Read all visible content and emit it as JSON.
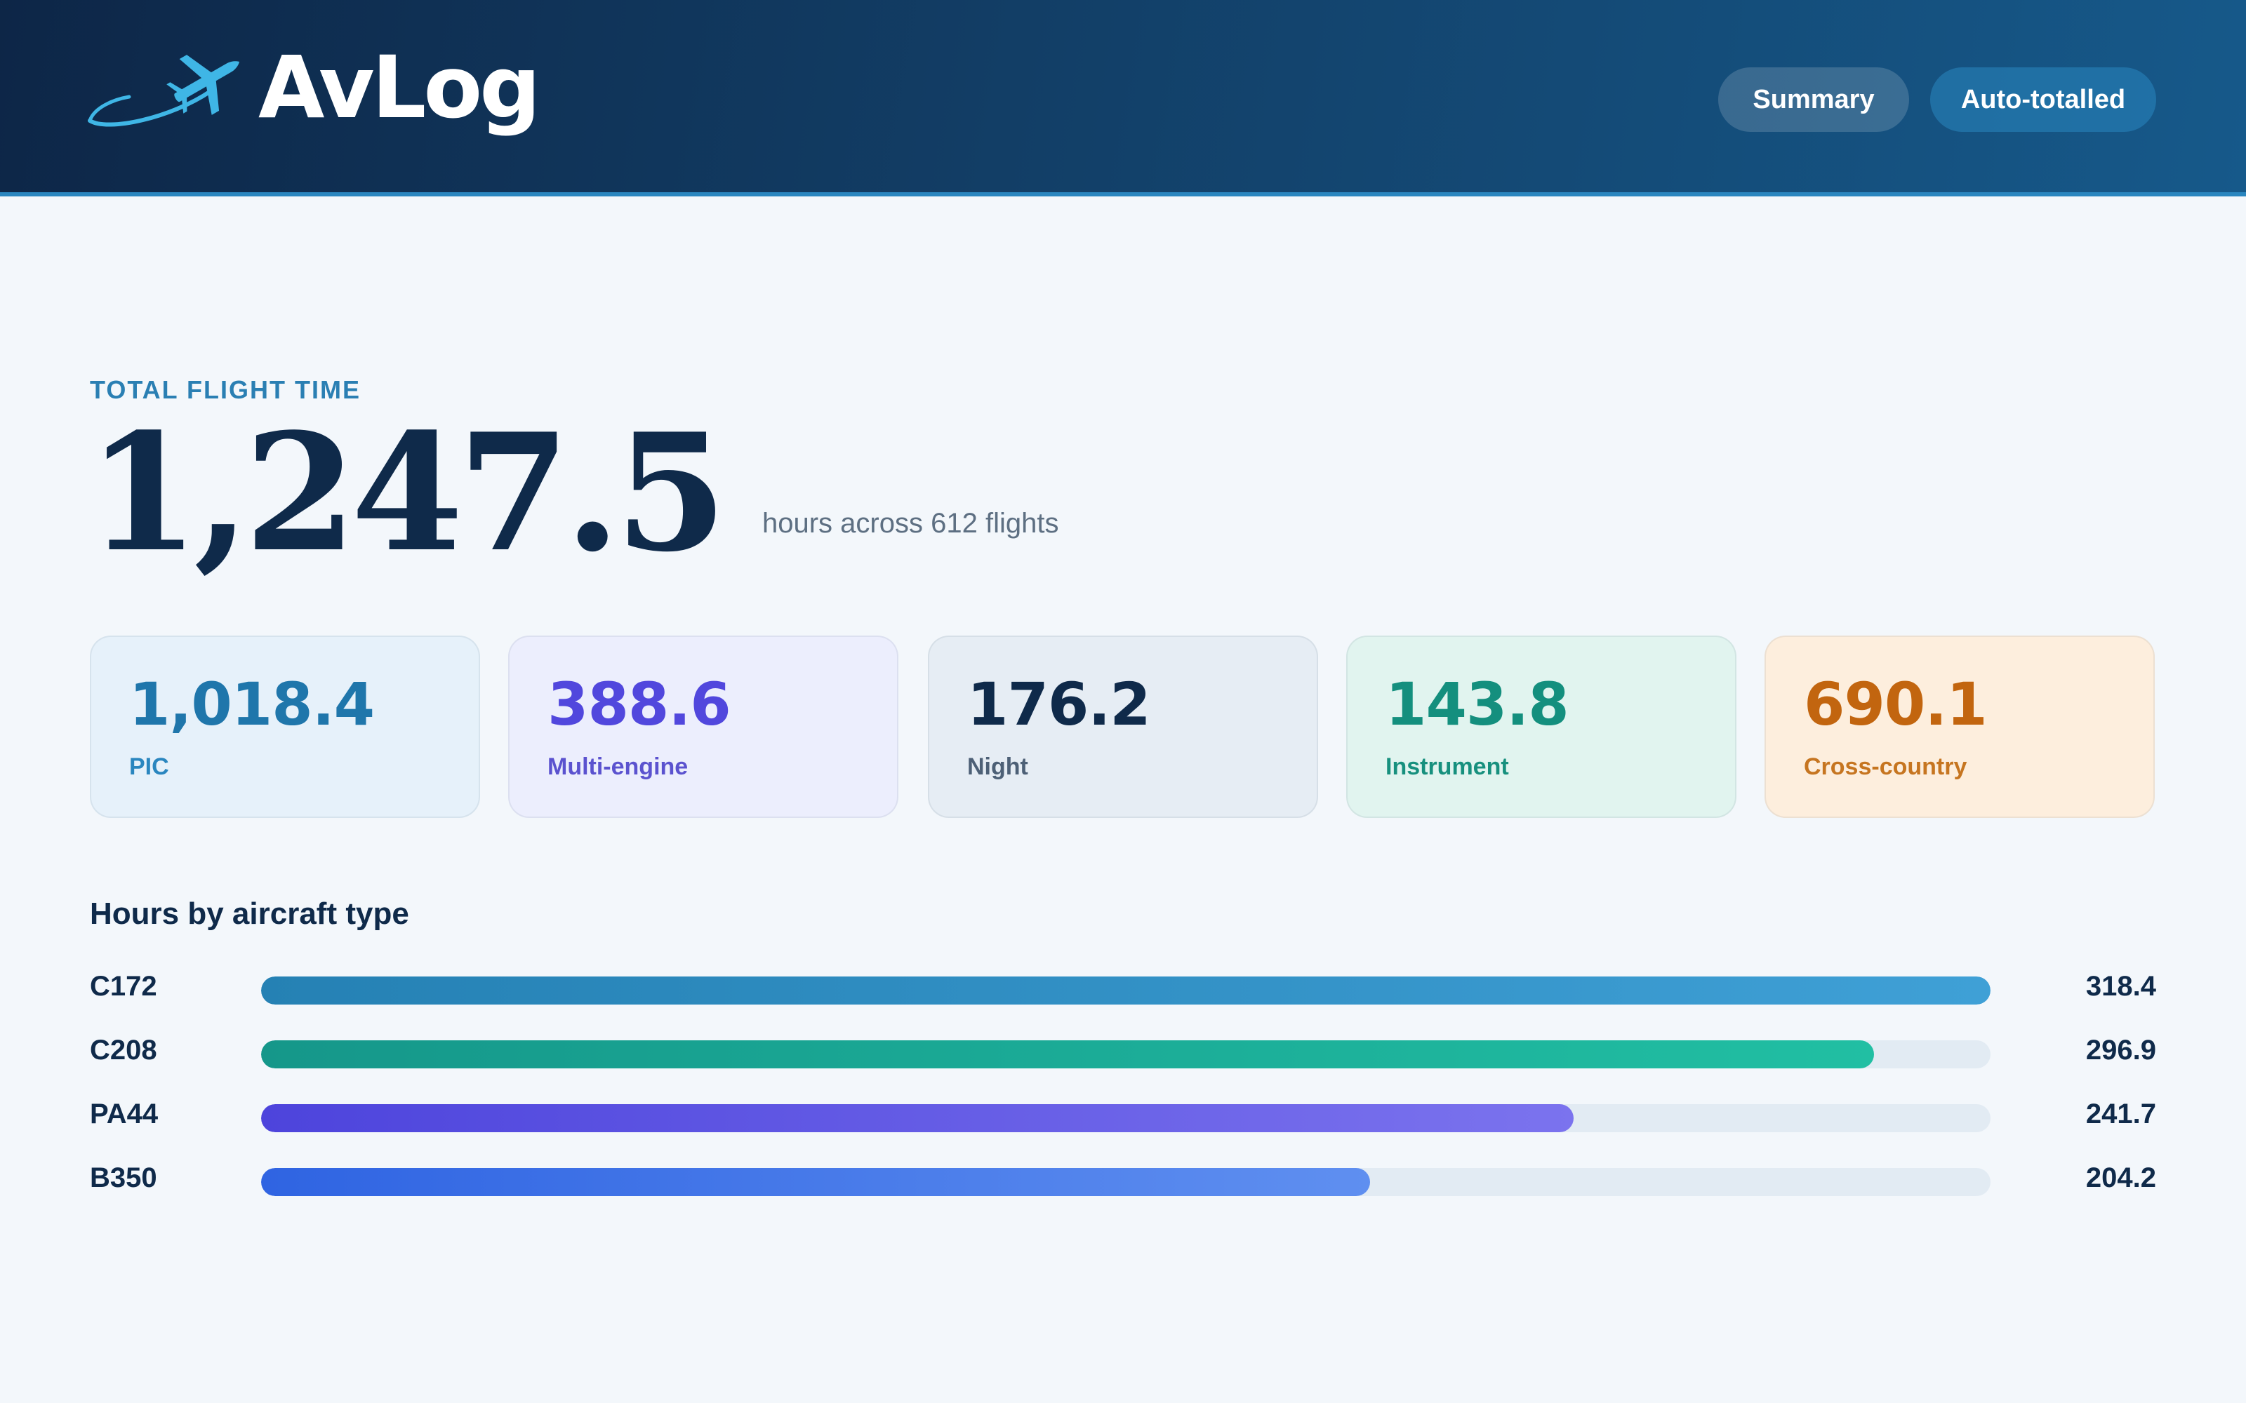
{
  "app": {
    "title": "AvLog"
  },
  "header": {
    "summary_label": "Summary",
    "auto_label": "Auto-totalled"
  },
  "total": {
    "label": "TOTAL FLIGHT TIME",
    "value": "1,247.5",
    "subtitle": "hours across 612 flights"
  },
  "stats": [
    {
      "value": "1,018.4",
      "label": "PIC"
    },
    {
      "value": "388.6",
      "label": "Multi-engine"
    },
    {
      "value": "176.2",
      "label": "Night"
    },
    {
      "value": "143.8",
      "label": "Instrument"
    },
    {
      "value": "690.1",
      "label": "Cross-country"
    }
  ],
  "aircraft": {
    "title": "Hours by aircraft type",
    "scale_max": 318.4,
    "rows": [
      {
        "type": "C172",
        "hours": 318.4,
        "hours_label": "318.4",
        "color_from": "#2581b4",
        "color_to": "#3fa0d6"
      },
      {
        "type": "C208",
        "hours": 296.9,
        "hours_label": "296.9",
        "color_from": "#15978a",
        "color_to": "#21bfa3"
      },
      {
        "type": "PA44",
        "hours": 241.7,
        "hours_label": "241.7",
        "color_from": "#4d44dc",
        "color_to": "#7b73ee"
      },
      {
        "type": "B350",
        "hours": 204.2,
        "hours_label": "204.2",
        "color_from": "#2f64e2",
        "color_to": "#5f8ff0"
      }
    ]
  }
}
